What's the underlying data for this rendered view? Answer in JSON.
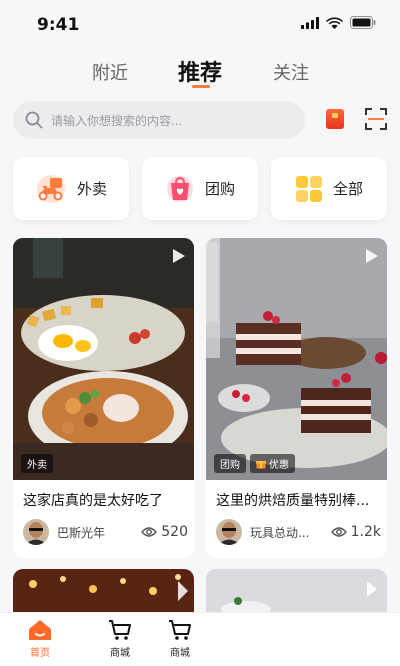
{
  "status_bar": {
    "time": "9:41"
  },
  "top_tabs": {
    "nearby": "附近",
    "recommend": "推荐",
    "follow": "关注"
  },
  "search": {
    "placeholder": "请输入你想搜索的内容..."
  },
  "categories": [
    {
      "label": "外卖"
    },
    {
      "label": "团购"
    },
    {
      "label": "全部"
    }
  ],
  "feed": [
    {
      "title": "这家店真的是太好吃了",
      "tags": [
        "外卖"
      ],
      "author": "巴斯光年",
      "views": "520"
    },
    {
      "title": "这里的烘焙质量特别棒...",
      "tags": [
        "团购",
        "优惠"
      ],
      "author": "玩具总动...",
      "views": "1.2k"
    }
  ],
  "bottom_nav": [
    {
      "label": "首页",
      "active": true
    },
    {
      "label": "商城"
    },
    {
      "label": "商城"
    }
  ],
  "colors": {
    "accent": "#ff7a3d",
    "brand_red": "#ff4d3a"
  }
}
